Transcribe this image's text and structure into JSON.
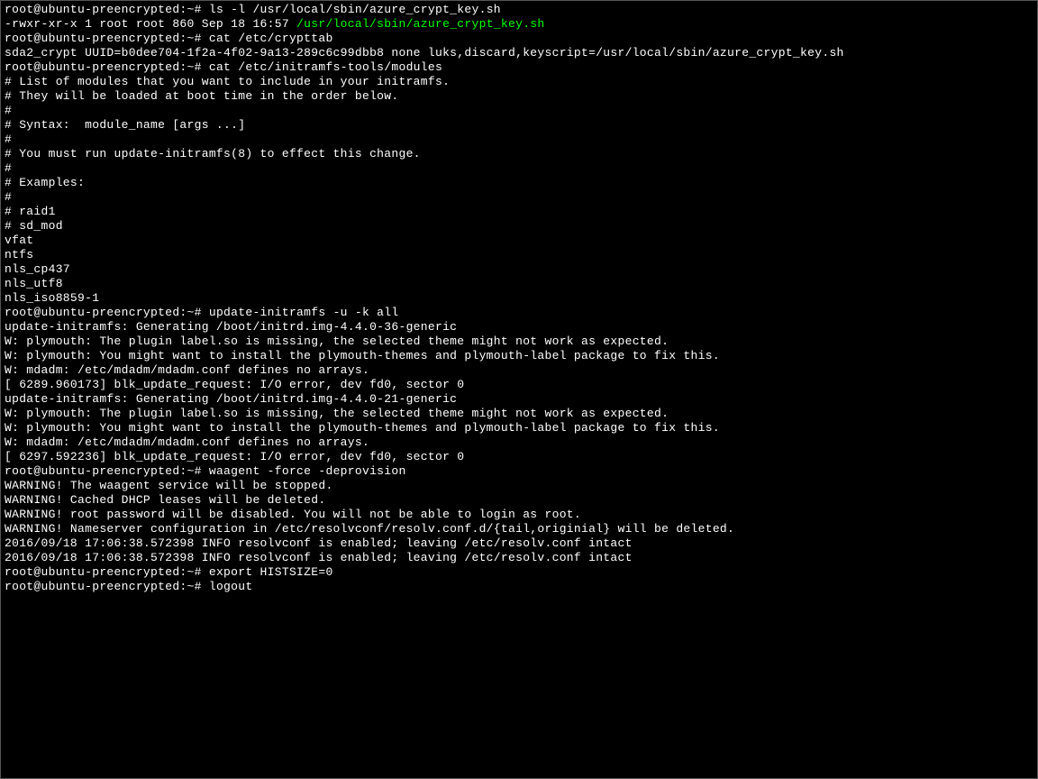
{
  "terminal": {
    "prompt": "root@ubuntu-preencrypted:~#",
    "lines": [
      {
        "type": "cmd",
        "command": "ls -l /usr/local/sbin/azure_crypt_key.sh"
      },
      {
        "type": "ls_output",
        "perms": "-rwxr-xr-x 1 root root 860 Sep 18 16:57 ",
        "path": "/usr/local/sbin/azure_crypt_key.sh"
      },
      {
        "type": "cmd",
        "command": "cat /etc/crypttab"
      },
      {
        "type": "plain",
        "text": "sda2_crypt UUID=b0dee704-1f2a-4f02-9a13-289c6c99dbb8 none luks,discard,keyscript=/usr/local/sbin/azure_crypt_key.sh"
      },
      {
        "type": "cmd",
        "command": "cat /etc/initramfs-tools/modules"
      },
      {
        "type": "plain",
        "text": "# List of modules that you want to include in your initramfs."
      },
      {
        "type": "plain",
        "text": "# They will be loaded at boot time in the order below."
      },
      {
        "type": "plain",
        "text": "#"
      },
      {
        "type": "plain",
        "text": "# Syntax:  module_name [args ...]"
      },
      {
        "type": "plain",
        "text": "#"
      },
      {
        "type": "plain",
        "text": "# You must run update-initramfs(8) to effect this change."
      },
      {
        "type": "plain",
        "text": "#"
      },
      {
        "type": "plain",
        "text": "# Examples:"
      },
      {
        "type": "plain",
        "text": "#"
      },
      {
        "type": "plain",
        "text": "# raid1"
      },
      {
        "type": "plain",
        "text": "# sd_mod"
      },
      {
        "type": "plain",
        "text": "vfat"
      },
      {
        "type": "plain",
        "text": "ntfs"
      },
      {
        "type": "plain",
        "text": "nls_cp437"
      },
      {
        "type": "plain",
        "text": "nls_utf8"
      },
      {
        "type": "plain",
        "text": "nls_iso8859-1"
      },
      {
        "type": "cmd",
        "command": "update-initramfs -u -k all"
      },
      {
        "type": "plain",
        "text": "update-initramfs: Generating /boot/initrd.img-4.4.0-36-generic"
      },
      {
        "type": "plain",
        "text": "W: plymouth: The plugin label.so is missing, the selected theme might not work as expected."
      },
      {
        "type": "plain",
        "text": "W: plymouth: You might want to install the plymouth-themes and plymouth-label package to fix this."
      },
      {
        "type": "plain",
        "text": "W: mdadm: /etc/mdadm/mdadm.conf defines no arrays."
      },
      {
        "type": "plain",
        "text": "[ 6289.960173] blk_update_request: I/O error, dev fd0, sector 0"
      },
      {
        "type": "plain",
        "text": "update-initramfs: Generating /boot/initrd.img-4.4.0-21-generic"
      },
      {
        "type": "plain",
        "text": "W: plymouth: The plugin label.so is missing, the selected theme might not work as expected."
      },
      {
        "type": "plain",
        "text": "W: plymouth: You might want to install the plymouth-themes and plymouth-label package to fix this."
      },
      {
        "type": "plain",
        "text": "W: mdadm: /etc/mdadm/mdadm.conf defines no arrays."
      },
      {
        "type": "plain",
        "text": "[ 6297.592236] blk_update_request: I/O error, dev fd0, sector 0"
      },
      {
        "type": "cmd",
        "command": "waagent -force -deprovision"
      },
      {
        "type": "plain",
        "text": "WARNING! The waagent service will be stopped."
      },
      {
        "type": "plain",
        "text": "WARNING! Cached DHCP leases will be deleted."
      },
      {
        "type": "plain",
        "text": "WARNING! root password will be disabled. You will not be able to login as root."
      },
      {
        "type": "plain",
        "text": "WARNING! Nameserver configuration in /etc/resolvconf/resolv.conf.d/{tail,originial} will be deleted."
      },
      {
        "type": "plain",
        "text": "2016/09/18 17:06:38.572398 INFO resolvconf is enabled; leaving /etc/resolv.conf intact"
      },
      {
        "type": "plain",
        "text": "2016/09/18 17:06:38.572398 INFO resolvconf is enabled; leaving /etc/resolv.conf intact"
      },
      {
        "type": "cmd",
        "command": "export HISTSIZE=0"
      },
      {
        "type": "cmd",
        "command": "logout"
      }
    ]
  }
}
